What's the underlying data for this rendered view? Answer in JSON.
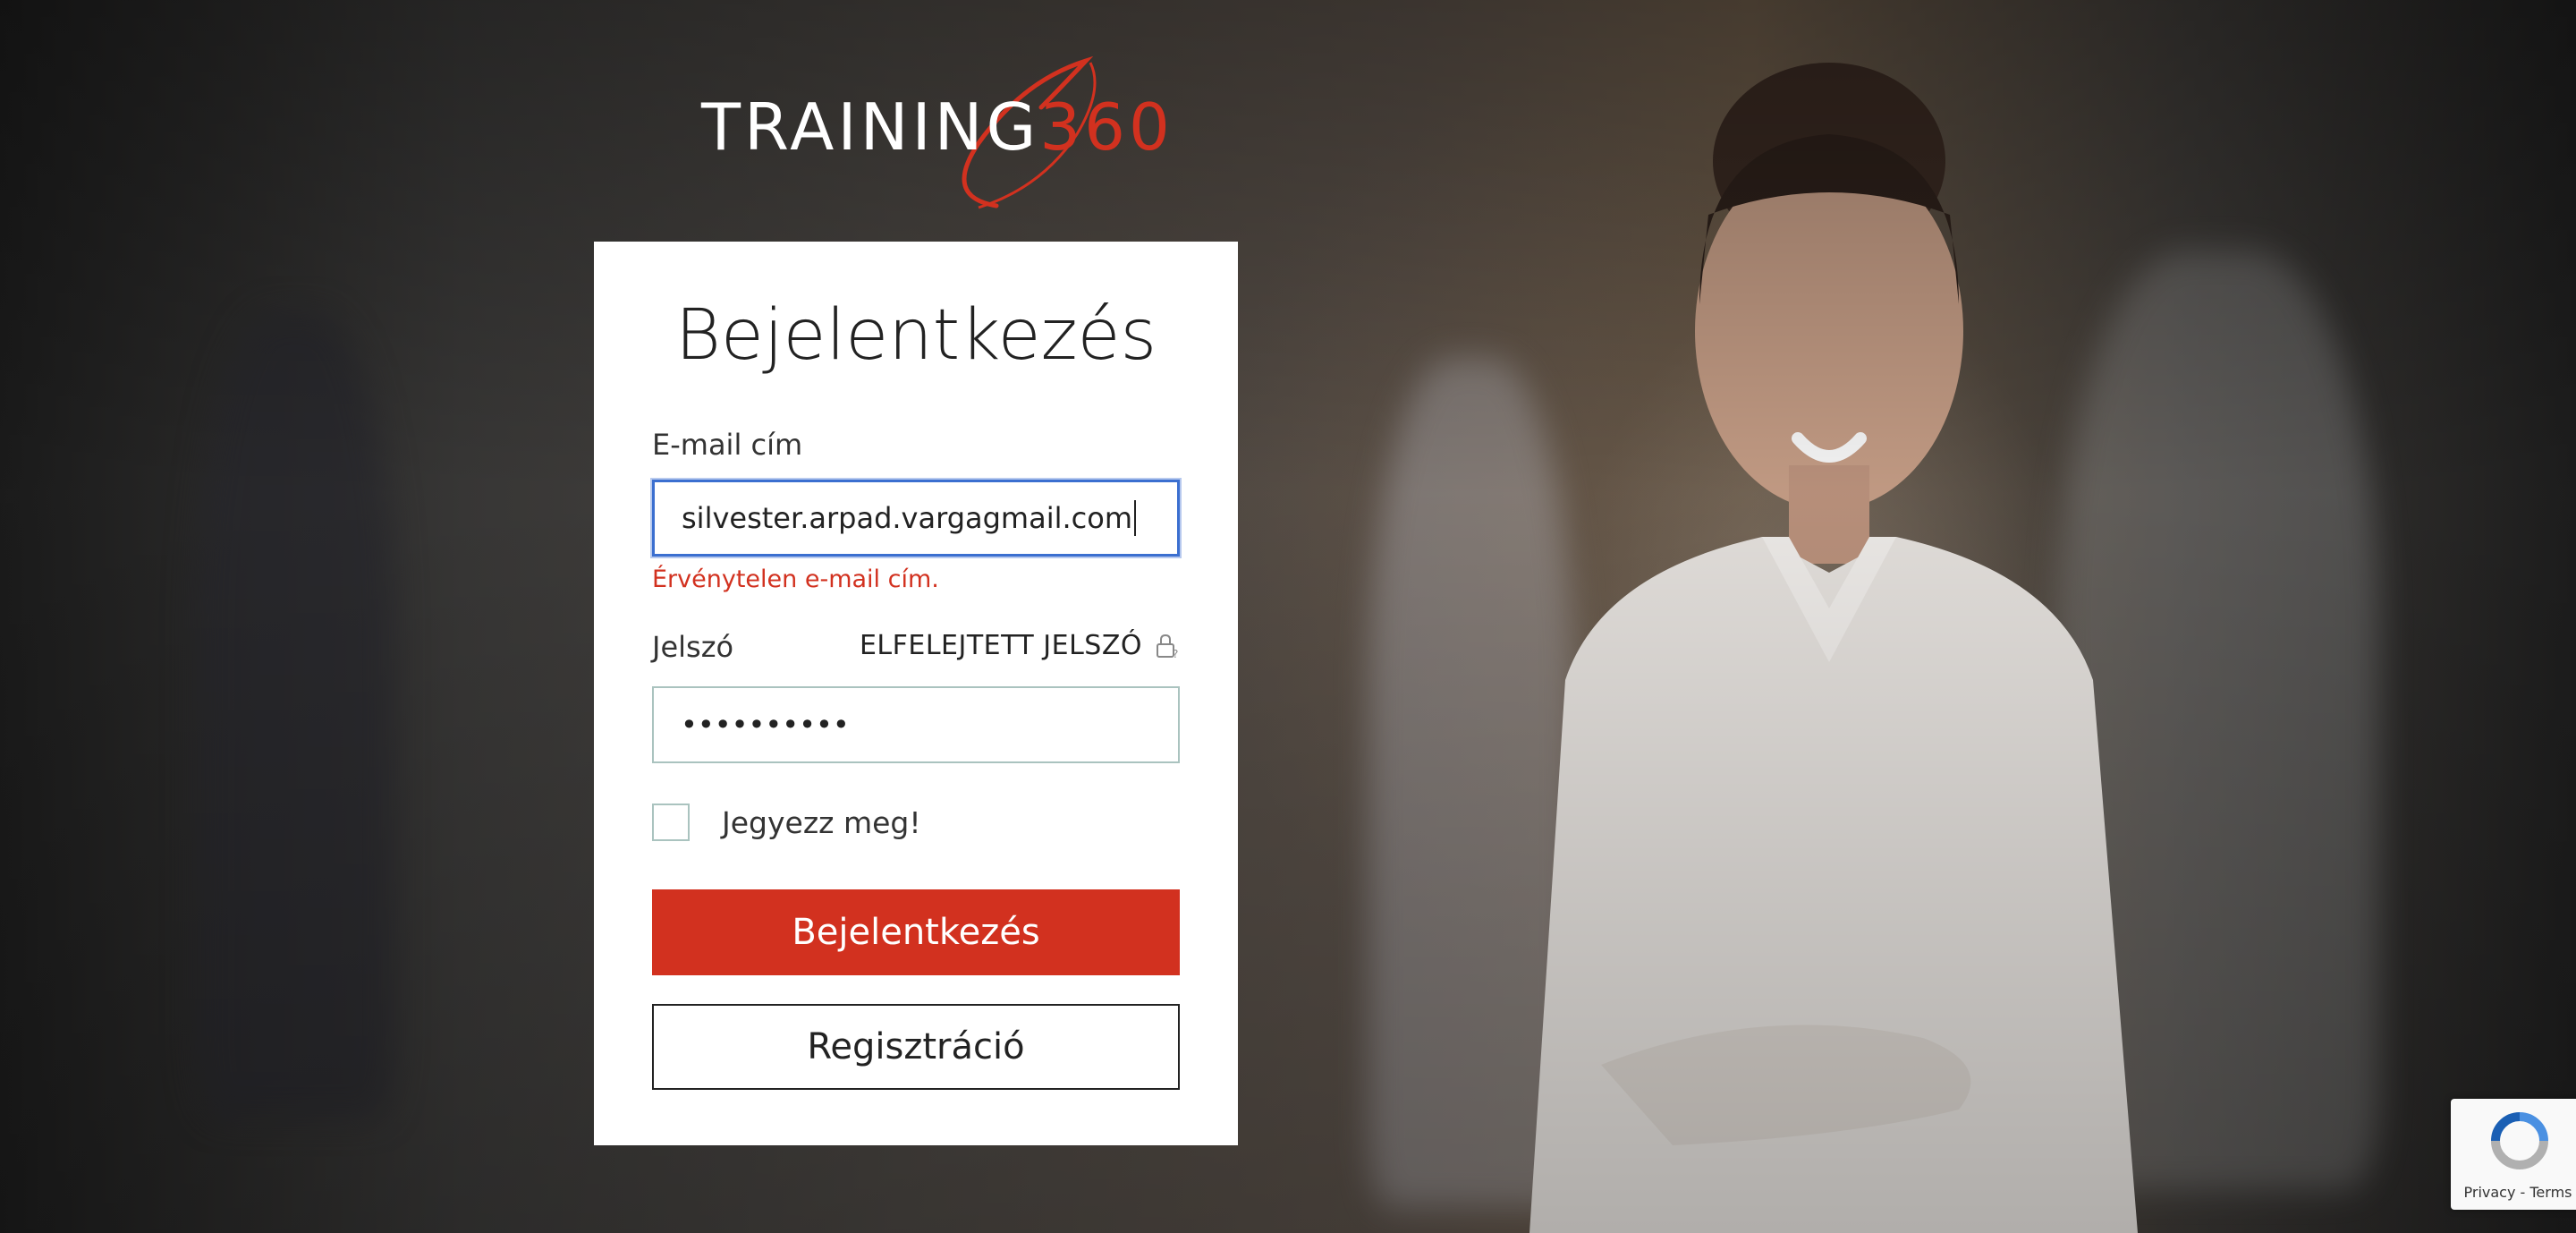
{
  "brand": {
    "logo_word": "TRAINING",
    "logo_number": "360",
    "accent_color": "#d2311f"
  },
  "login": {
    "title": "Bejelentkezés",
    "email_label": "E-mail cím",
    "email_value": "silvester.arpad.vargagmail.com",
    "email_error": "Érvénytelen e-mail cím.",
    "password_label": "Jelszó",
    "forgot_password": "ELFELEJTETT JELSZÓ",
    "password_value": "••••••••••",
    "remember_label": "Jegyezz meg!",
    "remember_checked": false,
    "submit_label": "Bejelentkezés",
    "register_label": "Regisztráció"
  },
  "recaptcha": {
    "links": "Privacy - Terms"
  },
  "icons": {
    "lock": "lock-icon",
    "recaptcha": "recaptcha-icon"
  }
}
